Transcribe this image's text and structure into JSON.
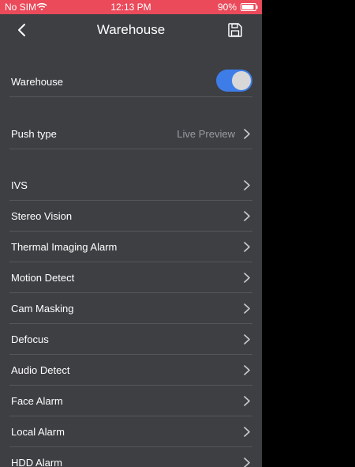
{
  "status_bar": {
    "carrier": "No SIM",
    "time": "12:13 PM",
    "battery": "90%",
    "battery_level": 0.9
  },
  "nav": {
    "title": "Warehouse",
    "back_icon": "chevron-left-icon",
    "save_icon": "floppy-disk-icon"
  },
  "warehouse_toggle": {
    "label": "Warehouse",
    "on": true,
    "accent_color": "#3e7de8"
  },
  "push_type": {
    "label": "Push type",
    "value": "Live Preview"
  },
  "alarm_items": [
    {
      "label": "IVS"
    },
    {
      "label": "Stereo Vision"
    },
    {
      "label": "Thermal Imaging Alarm"
    },
    {
      "label": "Motion Detect"
    },
    {
      "label": "Cam Masking"
    },
    {
      "label": "Defocus"
    },
    {
      "label": "Audio Detect"
    },
    {
      "label": "Face Alarm"
    },
    {
      "label": "Local Alarm"
    },
    {
      "label": "HDD Alarm"
    }
  ],
  "colors": {
    "status_bar": "#ea4a5a",
    "background": "#3d3f43",
    "secondary_text": "#9a9ca1"
  }
}
